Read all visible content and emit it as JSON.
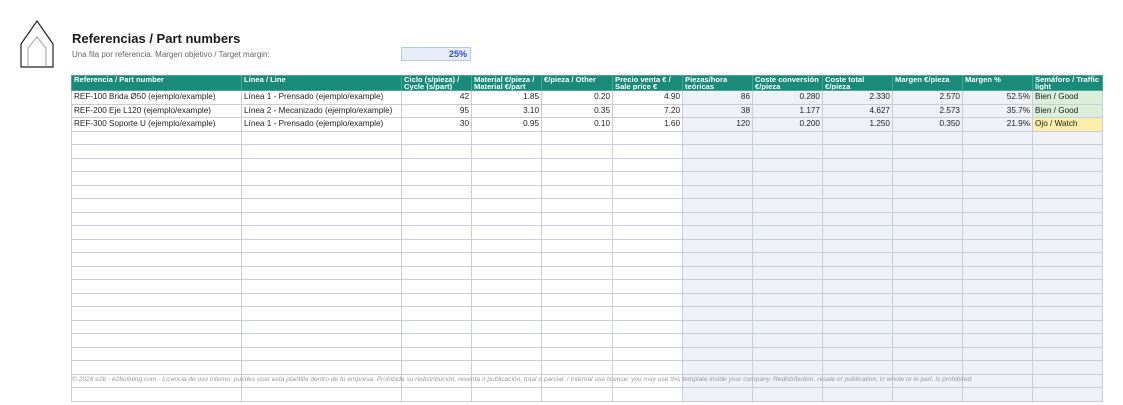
{
  "header": {
    "title": "Referencias / Part numbers",
    "subtitle": "Una fila por referencia. Margen objetivo / Target margin:",
    "target_margin": "25%"
  },
  "table": {
    "columns": [
      "Referencia / Part number",
      "Línea / Line",
      "Ciclo (s/pieza) / Cycle (s/part)",
      "Material €/pieza / Material €/part",
      "€/pieza / Other",
      "Precio venta € / Sale price €",
      "Piezas/hora teóricas",
      "Coste conversión €/pieza",
      "Coste total €/pieza",
      "Margen €/pieza",
      "Margen %",
      "Semáforo / Traffic light"
    ],
    "rows": [
      [
        "REF-100 Brida Ø50 (ejemplo/example)",
        "Línea 1 - Prensado (ejemplo/example)",
        "42",
        "1.85",
        "0.20",
        "4.90",
        "86",
        "0.280",
        "2.330",
        "2.570",
        "52.5%",
        "Bien / Good"
      ],
      [
        "REF-200 Eje L120 (ejemplo/example)",
        "Línea 2 - Mecanizado (ejemplo/example)",
        "95",
        "3.10",
        "0.35",
        "7.20",
        "38",
        "1.177",
        "4.627",
        "2.573",
        "35.7%",
        "Bien / Good"
      ],
      [
        "REF-300 Soporte U (ejemplo/example)",
        "Línea 1 - Prensado (ejemplo/example)",
        "30",
        "0.95",
        "0.10",
        "1.60",
        "120",
        "0.200",
        "1.250",
        "0.350",
        "21.9%",
        "Ojo / Watch"
      ]
    ],
    "empty_rows": 20
  },
  "footer": {
    "text": "© 2026 e2b - e2building.com - Licencia de uso interno: puedes usar esta plantilla dentro de tu empresa. Prohibida su redistribución, reventa o publicación, total o parcial. / Internal use license: you may use this template inside your company. Redistribution, resale or publication, in whole or in part, is prohibited."
  },
  "colors": {
    "header_bg": "#1a8a7a",
    "good": "#d9efd9",
    "watch": "#fbeeaa",
    "calc_bg": "#eef1f6"
  }
}
